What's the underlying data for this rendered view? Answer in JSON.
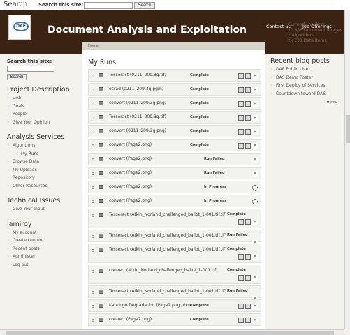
{
  "topbar": {
    "title": "Search",
    "search_label": "Search this site:",
    "search_button": "Search"
  },
  "header": {
    "logo_text": "DAE",
    "site_name": "Document Analysis and Exploitation",
    "links": [
      "Contact us",
      "Job Offerings"
    ],
    "feature_lines": [
      "Currently holding:",
      "20,986 Document Images",
      "2 Algorithms",
      "2k 738 Data Items"
    ]
  },
  "sidebar_left": {
    "search_label": "Search this site:",
    "search_button": "Search",
    "project_title": "Project Description",
    "project_items": [
      "DAE",
      "Goals",
      "People",
      "Give Your Opinion"
    ],
    "analysis_title": "Analysis Services",
    "analysis_items": [
      "Algorithms",
      "My Runs",
      "Browse Data",
      "My Uploads",
      "Repository",
      "Other Resources"
    ],
    "tech_title": "Technical Issues",
    "tech_items": [
      "Give Your Input"
    ],
    "user_title": "lamiroy",
    "user_items": [
      "My account",
      "Create content",
      "Recent posts",
      "Administer",
      "Log out"
    ]
  },
  "main": {
    "breadcrumb": "Home",
    "title": "My Runs",
    "runs": [
      {
        "name": "Tesseract (0211_209.3g.tif)",
        "status": "Complete"
      },
      {
        "name": "ocrad (0211_209.3g.pgm)",
        "status": "Complete"
      },
      {
        "name": "convert (0211_209.3g.png)",
        "status": "Complete"
      },
      {
        "name": "Tesseract (0211_209.3g.tif)",
        "status": "Complete"
      },
      {
        "name": "convert (0211_209.3g.png)",
        "status": "Complete"
      },
      {
        "name": "convert (Page2.png)",
        "status": "Complete"
      },
      {
        "name": "convert (Page2.png)",
        "status": "Run Failed"
      },
      {
        "name": "convert (Page2.png)",
        "status": "Run Failed"
      },
      {
        "name": "convert (Page2.png)",
        "status": "In Progress"
      },
      {
        "name": "convert (Page2.png)",
        "status": "In Progress"
      },
      {
        "name": "Tesseract (Atkin_Norland_challenged_ballot_1-001.tif.tif)",
        "status": "Complete"
      },
      {
        "name": "Tesseract (Atkin_Norland_challenged_ballot_1-001.tif.tif)",
        "status": "Run Failed"
      },
      {
        "name": "Tesseract (Atkin_Norland_challenged_ballot_1-001.tif.tif)",
        "status": "Complete"
      },
      {
        "name": "convert (Atkin_Norland_challenged_ballot_1-001.tif)",
        "status": "Complete"
      },
      {
        "name": "Tesseract (Atkin_Norland_challenged_ballot_1-001.tif.tif)",
        "status": "Run Failed"
      },
      {
        "name": "Kanungo Degradation (Page2.png.pbm)",
        "status": "Complete"
      },
      {
        "name": "convert (Page2.png)",
        "status": "Complete"
      }
    ]
  },
  "sidebar_right": {
    "title": "Recent blog posts",
    "items": [
      "DAE Public Live",
      "DAS Demo Poster",
      "First Deploy of Services",
      "Countdown toward DAS"
    ],
    "more": "more"
  }
}
